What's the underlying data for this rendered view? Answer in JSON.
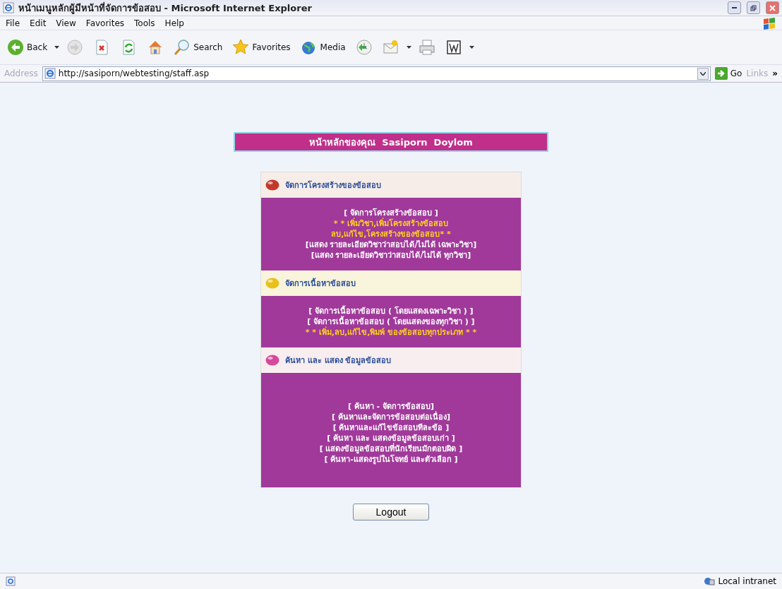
{
  "window": {
    "title": "หน้าเมนูหลักผู้มีหน้าที่จัดการข้อสอบ - Microsoft Internet Explorer"
  },
  "menu": [
    "File",
    "Edit",
    "View",
    "Favorites",
    "Tools",
    "Help"
  ],
  "toolbar": [
    {
      "kind": "back",
      "label": "Back"
    },
    {
      "kind": "forward"
    },
    {
      "kind": "stop"
    },
    {
      "kind": "refresh"
    },
    {
      "kind": "home"
    },
    {
      "kind": "search",
      "label": "Search"
    },
    {
      "kind": "favorites",
      "label": "Favorites"
    },
    {
      "kind": "media",
      "label": "Media"
    },
    {
      "kind": "history"
    },
    {
      "kind": "mail"
    },
    {
      "kind": "print"
    },
    {
      "kind": "word"
    }
  ],
  "address": {
    "label": "Address",
    "value": "http://sasiporn/webtesting/staff.asp",
    "go": "Go",
    "links": "Links",
    "more": "»"
  },
  "page": {
    "banner": "หน้าหลักของคุณ  Sasiporn  Doylom",
    "sections": [
      {
        "title": "จัดการโครงสร้างของข้อสอบ",
        "color": "#c0392b",
        "lines": [
          {
            "kind": "link",
            "text": "[ จัดการโครงสร้างข้อสอบ ]"
          },
          {
            "kind": "note",
            "text": "* * เพิ่มวิชา,เพิ่มโครงสร้างข้อสอบ"
          },
          {
            "kind": "note",
            "text": "ลบ,แก้ไข,โครงสร้างของข้อสอบ* *"
          },
          {
            "kind": "link",
            "text": "[แสดง รายละเอียดวิชาว่าสอบได้/ไม่ได้ เฉพาะวิชา]"
          },
          {
            "kind": "link",
            "text": "[แสดง รายละเอียดวิชาว่าสอบได้/ไม่ได้ ทุกวิชา]"
          }
        ]
      },
      {
        "title": "จัดการเนื้อหาข้อสอบ",
        "color": "#e8c21a",
        "lines": [
          {
            "kind": "link",
            "text": "[ จัดการเนื้อหาข้อสอบ ( โดยแสดงเฉพาะวิชา ) ]"
          },
          {
            "kind": "link",
            "text": "[ จัดการเนื้อหาข้อสอบ ( โดยแสดงของทุกวิชา ) ]"
          },
          {
            "kind": "note",
            "text": "* * เพิ่ม,ลบ,แก้ไข,พิมพ์ ของข้อสอบทุกประเภท * *"
          }
        ]
      },
      {
        "title": "ค้นหา และ แสดง ข้อมูลข้อสอบ",
        "color": "#d6489a",
        "lines": [
          {
            "kind": "link",
            "text": "[ ค้นหา - จัดการข้อสอบ]"
          },
          {
            "kind": "link",
            "text": "[ ค้นหาและจัดการข้อสอบต่อเนื่อง]"
          },
          {
            "kind": "link",
            "text": "[ ค้นหาและแก้ไขข้อสอบทีละข้อ ]"
          },
          {
            "kind": "link",
            "text": "[ ค้นหา และ แสดงข้อมูลข้อสอบเก่า ]"
          },
          {
            "kind": "link",
            "text": "[ แสดงข้อมูลข้อสอบที่นักเรียนมักตอบผิด ]"
          },
          {
            "kind": "link",
            "text": "[ ค้นหา-แสดงรูปในโจทย์ และตัวเลือก ]"
          }
        ]
      }
    ],
    "logout": "Logout"
  },
  "status": {
    "zone": "Local intranet"
  }
}
